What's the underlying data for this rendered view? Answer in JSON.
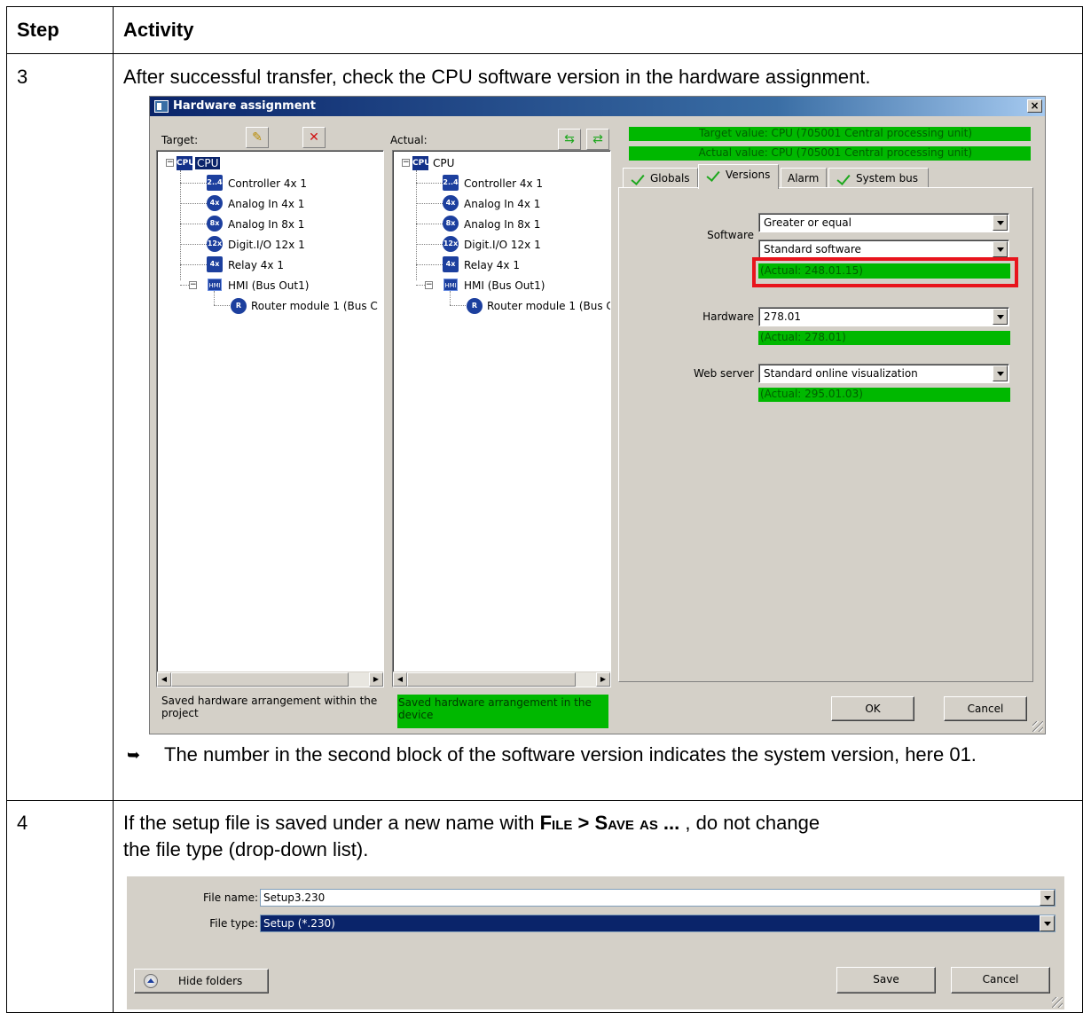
{
  "table": {
    "header_step": "Step",
    "header_activity": "Activity",
    "row3_step": "3",
    "row3_activity": "After successful transfer, check the CPU software version in the hardware assignment.",
    "row3_result_bullet": "➥",
    "row3_result": "The number in the second block of the software version indicates the system version, here 01.",
    "row4_step": "4",
    "row4_text_a": "If the setup file is saved under a new name with ",
    "row4_menu_file": "File",
    "row4_menu_sep": " > ",
    "row4_menu_save": "Save as ...",
    "row4_text_b": " , do not change",
    "row4_text_c": "the file type (drop-down list)."
  },
  "hw_dialog": {
    "title": "Hardware assignment",
    "close": "×",
    "target_label": "Target:",
    "actual_label": "Actual:",
    "target_tree": {
      "root": "CPU",
      "root_icon": "CPU",
      "children": [
        {
          "label": "Controller 4x 1",
          "icon": "2..4"
        },
        {
          "label": "Analog In 4x 1",
          "icon": "4x"
        },
        {
          "label": "Analog In 8x 1",
          "icon": "8x"
        },
        {
          "label": "Digit.I/O 12x 1",
          "icon": "12x"
        },
        {
          "label": "Relay 4x 1",
          "icon": "4x"
        },
        {
          "label": "HMI (Bus Out1)",
          "icon": "HMI"
        }
      ],
      "grandchild": "Router module 1 (Bus C",
      "grandchild_icon": "R"
    },
    "actual_tree": {
      "root": "CPU",
      "root_icon": "CPU",
      "children": [
        {
          "label": "Controller 4x 1",
          "icon": "2..4"
        },
        {
          "label": "Analog In 4x 1",
          "icon": "4x"
        },
        {
          "label": "Analog In 8x 1",
          "icon": "8x"
        },
        {
          "label": "Digit.I/O 12x 1",
          "icon": "12x"
        },
        {
          "label": "Relay 4x 1",
          "icon": "4x"
        },
        {
          "label": "HMI (Bus Out1)",
          "icon": "HMI"
        }
      ],
      "grandchild": "Router module 1 (Bus C",
      "grandchild_icon": "R"
    },
    "target_value": "Target value: CPU (705001 Central processing unit)",
    "actual_value": "Actual value: CPU (705001 Central processing unit)",
    "tabs": [
      "Globals",
      "Versions",
      "Alarm",
      "System bus"
    ],
    "software_label": "Software",
    "software_compare": "Greater or equal",
    "software_value": "Standard software",
    "software_actual": "(Actual: 248.01.15)",
    "hardware_label": "Hardware",
    "hardware_value": "278.01",
    "hardware_actual": "(Actual: 278.01)",
    "webserver_label": "Web server",
    "webserver_value": "Standard online visualization",
    "webserver_actual": "(Actual: 295.01.03)",
    "target_status": "Saved hardware arrangement within the project",
    "actual_status": "Saved hardware arrangement in the device",
    "ok": "OK",
    "cancel": "Cancel",
    "colors": {
      "ok_green": "#00b800",
      "highlight_red": "#e8141c",
      "title_blue": "#0a246a"
    }
  },
  "save_dialog": {
    "file_name_label": "File name:",
    "file_name_value": "Setup3.230",
    "file_type_label": "File type:",
    "file_type_value": "Setup (*.230)",
    "hide_folders": "Hide folders",
    "save": "Save",
    "cancel": "Cancel"
  }
}
